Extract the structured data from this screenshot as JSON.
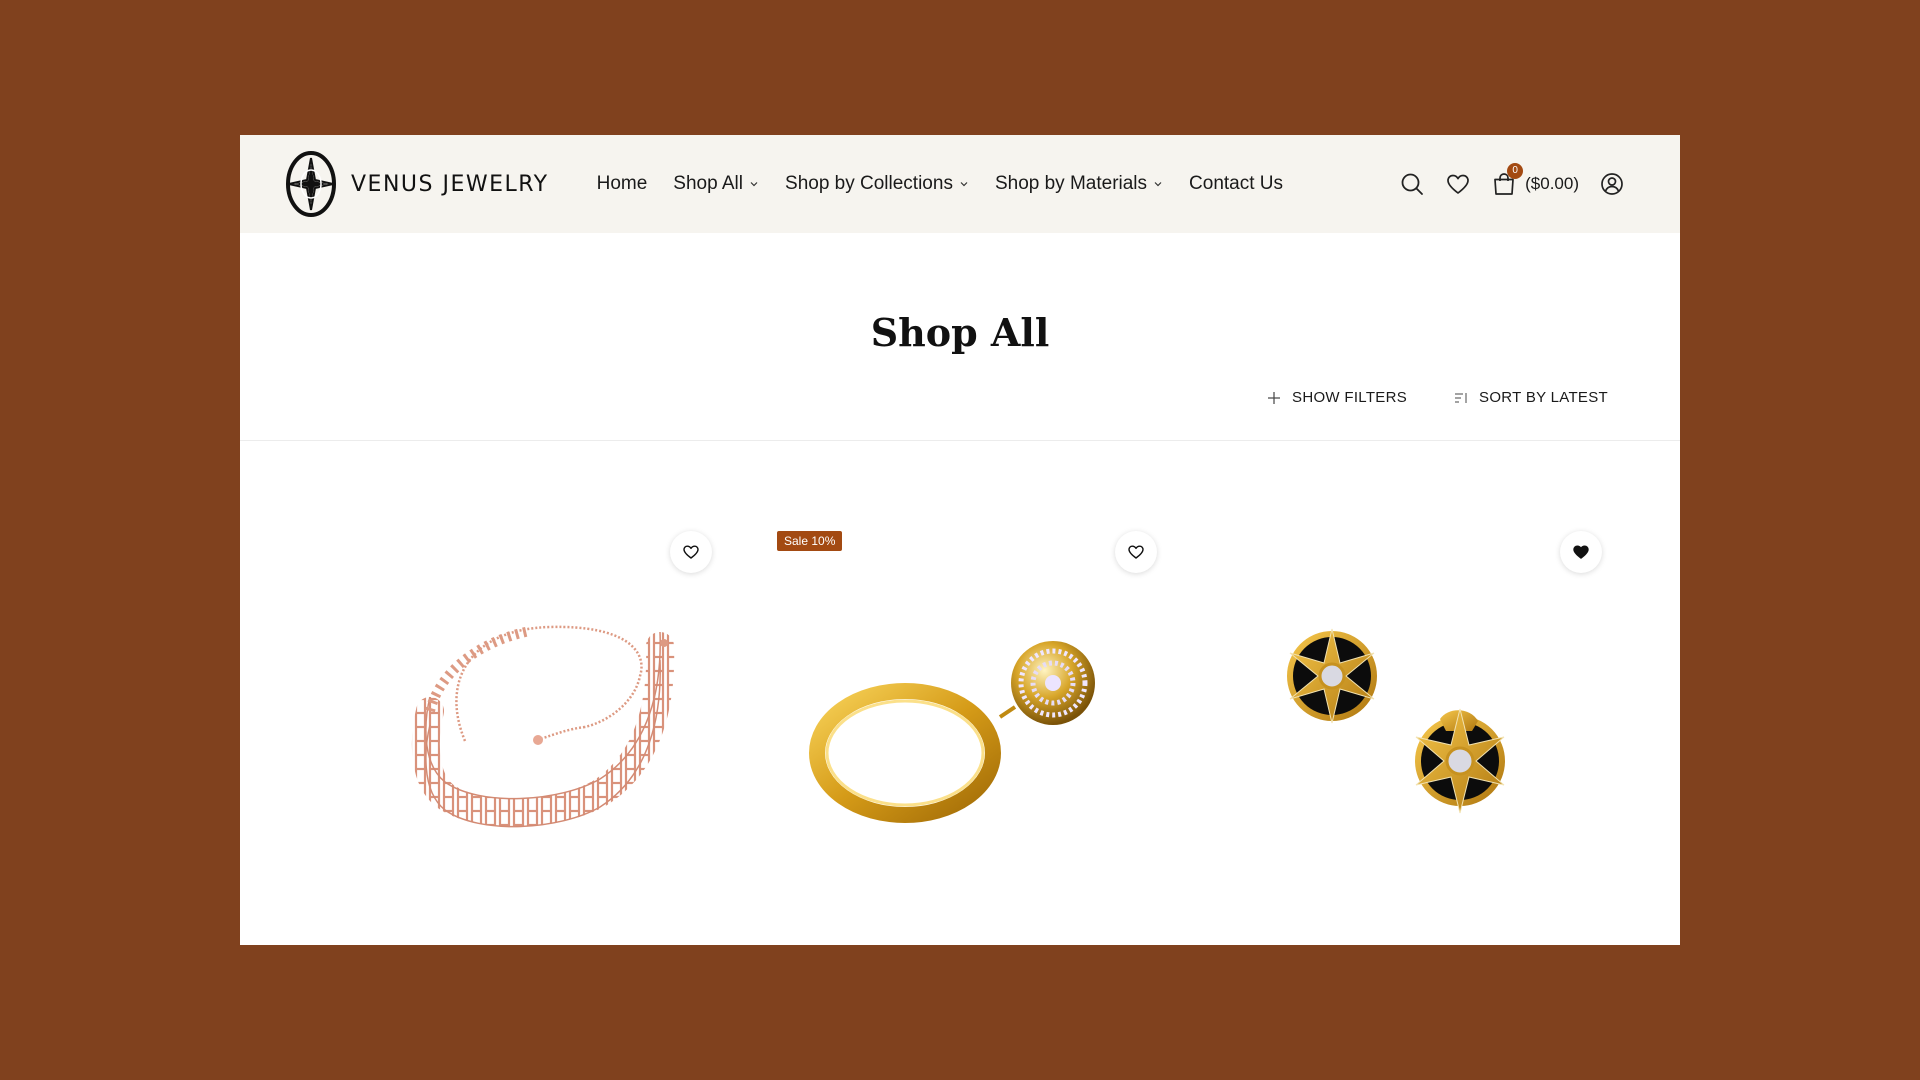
{
  "brand": {
    "name": "VENUS JEWELRY",
    "logo_icon": "compass-star-logo"
  },
  "nav": {
    "items": [
      {
        "label": "Home",
        "has_dropdown": false
      },
      {
        "label": "Shop All",
        "has_dropdown": true
      },
      {
        "label": "Shop by Collections",
        "has_dropdown": true
      },
      {
        "label": "Shop by Materials",
        "has_dropdown": true
      },
      {
        "label": "Contact Us",
        "has_dropdown": false
      }
    ]
  },
  "header_icons": {
    "search": "search-icon",
    "wishlist": "heart-icon",
    "cart": "shopping-bag-icon",
    "account": "user-icon"
  },
  "cart": {
    "count": "0",
    "total": "($0.00)"
  },
  "page": {
    "title": "Shop All"
  },
  "toolbar": {
    "filters_label": "SHOW FILTERS",
    "sort_label": "SORT BY LATEST"
  },
  "products": [
    {
      "image": "rose-gold-ladder-necklace",
      "badge": "",
      "wishlisted": false
    },
    {
      "image": "gold-ring-with-pave-ball-charm",
      "badge": "Sale 10%",
      "wishlisted": false
    },
    {
      "image": "gold-black-star-stud-earrings",
      "badge": "",
      "wishlisted": true
    }
  ],
  "colors": {
    "background": "#80411e",
    "header_bg": "#f6f4ef",
    "accent": "#a34a12",
    "text": "#1a1a1a"
  }
}
